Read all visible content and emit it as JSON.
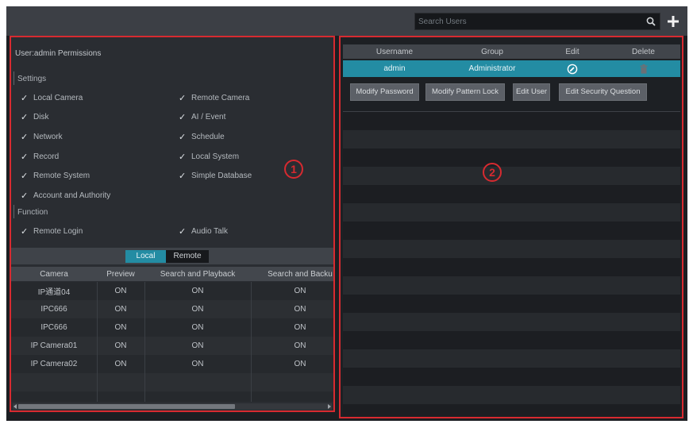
{
  "header": {
    "search": {
      "placeholder": "Search Users",
      "value": ""
    },
    "search_icon": "search-icon",
    "add_icon": "plus-icon"
  },
  "permissions": {
    "title": "User:admin Permissions",
    "check_glyph": "✓",
    "sections": [
      {
        "label": "Settings",
        "items": [
          {
            "label": "Local Camera",
            "checked": true
          },
          {
            "label": "Remote Camera",
            "checked": true
          },
          {
            "label": "Disk",
            "checked": true
          },
          {
            "label": "AI / Event",
            "checked": true
          },
          {
            "label": "Network",
            "checked": true
          },
          {
            "label": "Schedule",
            "checked": true
          },
          {
            "label": "Record",
            "checked": true
          },
          {
            "label": "Local System",
            "checked": true
          },
          {
            "label": "Remote System",
            "checked": true
          },
          {
            "label": "Simple Database",
            "checked": true
          },
          {
            "label": "Account and Authority",
            "checked": true
          }
        ]
      },
      {
        "label": "Function",
        "items": [
          {
            "label": "Remote Login",
            "checked": true
          },
          {
            "label": "Audio Talk",
            "checked": true
          }
        ]
      }
    ]
  },
  "camera_permissions": {
    "tabs": [
      {
        "label": "Local",
        "active": true
      },
      {
        "label": "Remote",
        "active": false
      }
    ],
    "columns": [
      "Camera",
      "Preview",
      "Search and Playback",
      "Search and Backu"
    ],
    "rows": [
      [
        "IP通道04",
        "ON",
        "ON",
        "ON"
      ],
      [
        "IPC666",
        "ON",
        "ON",
        "ON"
      ],
      [
        "IPC666",
        "ON",
        "ON",
        "ON"
      ],
      [
        "IP Camera01",
        "ON",
        "ON",
        "ON"
      ],
      [
        "IP Camera02",
        "ON",
        "ON",
        "ON"
      ]
    ]
  },
  "users": {
    "columns": [
      "Username",
      "Group",
      "Edit",
      "Delete"
    ],
    "rows": [
      {
        "username": "admin",
        "group": "Administrator",
        "edit_icon": "edit-icon",
        "delete_icon": "trash-icon",
        "selected": true
      }
    ],
    "actions": [
      "Modify Password",
      "Modify Pattern Lock",
      "Edit User",
      "Edit Security Question"
    ]
  },
  "annotations": [
    "1",
    "2"
  ],
  "colors": {
    "accent": "#238ca3",
    "annotation": "#d72a30",
    "top_bar": "#3c3f45",
    "panel": "#2a2d32",
    "list_bg": "#1d2024",
    "button": "#5c6067",
    "app_bg": "#1c1e22",
    "text": "#b8bcc2"
  }
}
